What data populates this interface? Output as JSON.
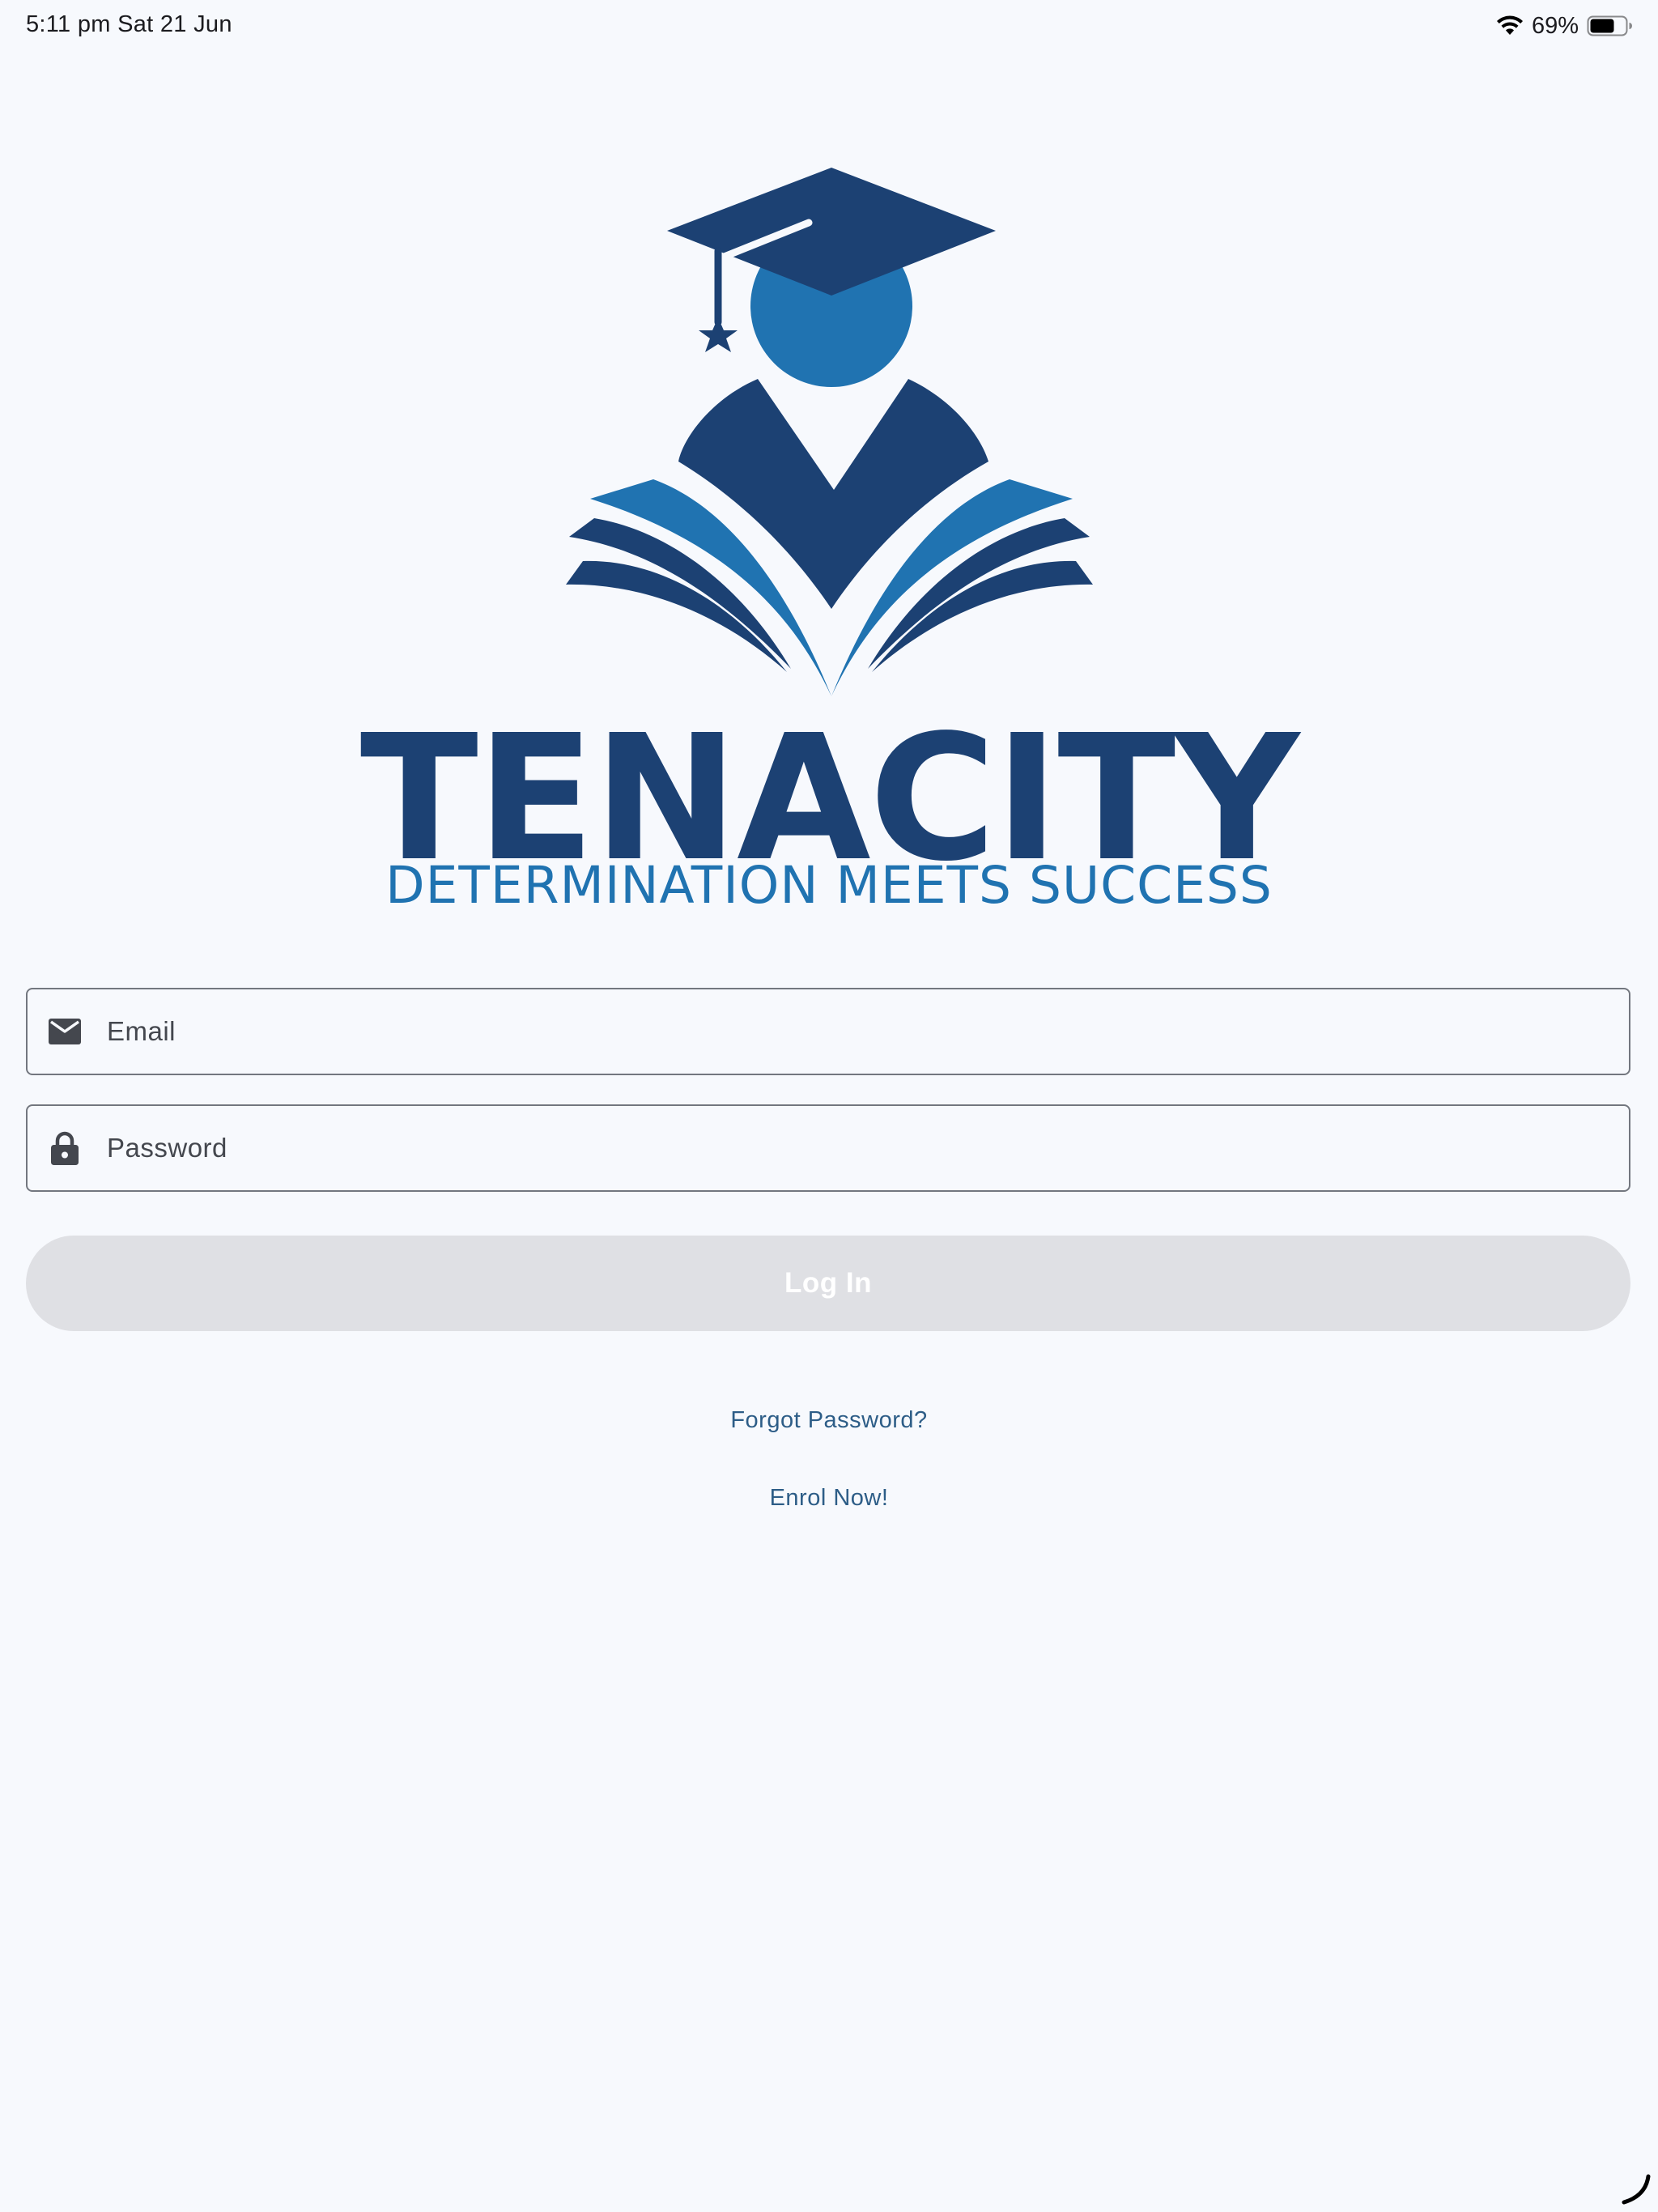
{
  "status_bar": {
    "time_date": "5:11 pm   Sat 21 Jun",
    "battery_percent": "69%",
    "battery_level": 0.69
  },
  "brand": {
    "name": "TENACITY",
    "tagline": "DETERMINATION MEETS SUCCESS",
    "colors": {
      "primary_dark": "#1c4173",
      "primary_light": "#2073b1"
    }
  },
  "form": {
    "email": {
      "icon": "mail-icon",
      "placeholder": "Email",
      "value": ""
    },
    "password": {
      "icon": "lock-icon",
      "placeholder": "Password",
      "value": ""
    },
    "login_label": "Log In"
  },
  "links": {
    "forgot_password": "Forgot Password?",
    "enrol": "Enrol Now!"
  }
}
